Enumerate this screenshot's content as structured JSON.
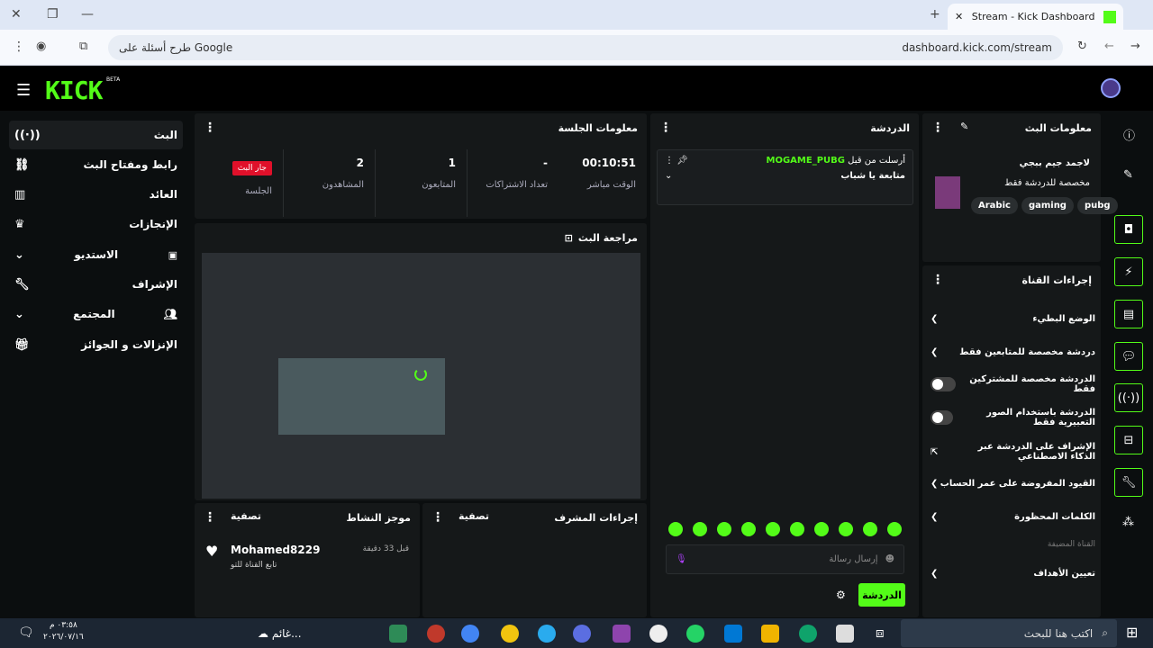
{
  "browser": {
    "tab_title": "Stream - Kick Dashboard",
    "url": "dashboard.kick.com/stream",
    "search_hint": "طرح أسئلة على Google"
  },
  "brand": {
    "logo": "KICK",
    "beta": "BETA"
  },
  "sidebar": {
    "items": [
      {
        "label": "البث",
        "icon": "broadcast-icon"
      },
      {
        "label": "رابط ومفتاح البث",
        "icon": "link-icon"
      },
      {
        "label": "العائد",
        "icon": "bar-chart-icon"
      },
      {
        "label": "الإنجازات",
        "icon": "trophy-icon"
      },
      {
        "label": "الاستديو",
        "icon": "studio-icon"
      },
      {
        "label": "الإشراف",
        "icon": "wrench-icon"
      },
      {
        "label": "المجتمع",
        "icon": "people-icon"
      },
      {
        "label": "الإنزالات و الجوائز",
        "icon": "gift-icon"
      }
    ]
  },
  "session": {
    "title": "معلومات الجلسة",
    "live": "جار البث",
    "live_label": "الجلسة",
    "viewers": "2",
    "viewers_label": "المشاهدون",
    "followers": "1",
    "followers_label": "المتابعون",
    "subs": "-",
    "subs_label": "تعداد الاشتراكات",
    "time": "00:10:51",
    "time_label": "الوقت مباشر"
  },
  "review": {
    "title": "مراجعة البث"
  },
  "activity": {
    "title": "موجز النشاط",
    "filter": "تصفية",
    "user": "Mohamed8229",
    "action": "تابع القناة للتو",
    "time": "قبل 33 دقيقة"
  },
  "modactions": {
    "title": "إجراءات المشرف",
    "filter": "تصفية"
  },
  "chat": {
    "title": "الدردشة",
    "from": "أرسلت من قبل",
    "user": "MOGAME_PUBG",
    "message": "متابعة يا شباب",
    "placeholder": "إرسال رسالة",
    "send": "الدردشة"
  },
  "streaminfo": {
    "title": "معلومات البث",
    "name": "لاجمد جيم ببجي",
    "desc": "مخصصة للدردشة فقط",
    "tags": [
      "Arabic",
      "gaming",
      "pubg"
    ]
  },
  "channel": {
    "title": "إجراءات القناة",
    "actions": [
      "الوضع البطيء",
      "دردشة مخصصة للمتابعين فقط",
      "الدردشة مخصصة للمشتركين فقط",
      "الدردشة باستخدام الصور التعبيرية فقط",
      "الإشراف على الدردشة عبر الذكاء الاصطناعي",
      "القيود المفروضة على عمر الحساب",
      "الكلمات المحظورة"
    ],
    "section": "القناة المضيفة",
    "goals": "تعيين الأهداف"
  },
  "taskbar": {
    "search": "اكتب هنا للبحث",
    "weather": "غائم...",
    "time": "٠٣:٥٨ م",
    "date": "٢٠٢٦/٠٧/١٦"
  }
}
